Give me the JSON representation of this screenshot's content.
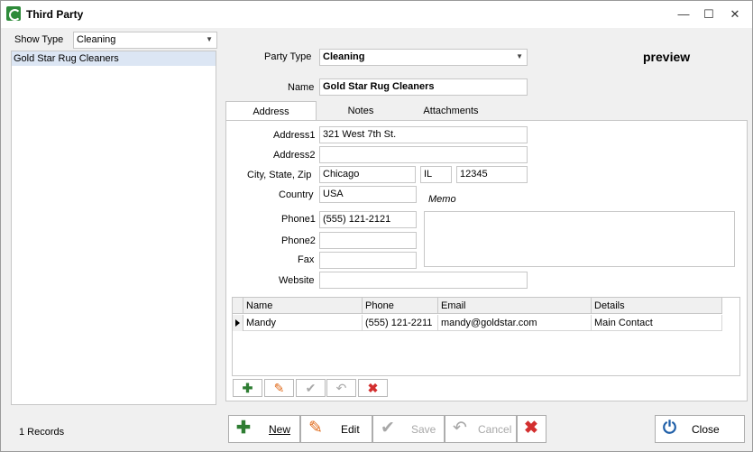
{
  "window": {
    "title": "Third Party"
  },
  "left": {
    "show_type_label": "Show Type",
    "show_type_value": "Cleaning",
    "items": [
      "Gold Star Rug Cleaners"
    ],
    "records_label": "1 Records"
  },
  "form": {
    "party_type_label": "Party Type",
    "party_type_value": "Cleaning",
    "name_label": "Name",
    "name_value": "Gold Star Rug Cleaners",
    "preview_label": "preview"
  },
  "tabs": [
    "Address",
    "Notes",
    "Attachments"
  ],
  "address": {
    "address1_label": "Address1",
    "address1_value": "321 West 7th St.",
    "address2_label": "Address2",
    "address2_value": "",
    "csz_label": "City, State, Zip",
    "city_value": "Chicago",
    "state_value": "IL",
    "zip_value": "12345",
    "country_label": "Country",
    "country_value": "USA",
    "memo_label": "Memo",
    "phone1_label": "Phone1",
    "phone1_value": "(555) 121-2121",
    "phone2_label": "Phone2",
    "phone2_value": "",
    "fax_label": "Fax",
    "fax_value": "",
    "website_label": "Website",
    "website_value": ""
  },
  "contacts": {
    "columns": [
      "Name",
      "Phone",
      "Email",
      "Details"
    ],
    "rows": [
      [
        "Mandy",
        "(555) 121-2211",
        "mandy@goldstar.com",
        "Main Contact"
      ]
    ]
  },
  "buttons": {
    "new": "New",
    "edit": "Edit",
    "save": "Save",
    "cancel": "Cancel",
    "close": "Close"
  },
  "colors": {
    "add_green": "#2e7d32",
    "edit_orange": "#e06a1a",
    "delete_red": "#d32f2f",
    "close_blue": "#1f5fa8",
    "selection": "#dce6f4"
  },
  "icons": {
    "app": "app-icon",
    "new": "plus-icon",
    "edit": "pencil-icon",
    "save": "check-icon",
    "cancel": "undo-icon",
    "delete": "x-icon",
    "close": "power-icon"
  }
}
